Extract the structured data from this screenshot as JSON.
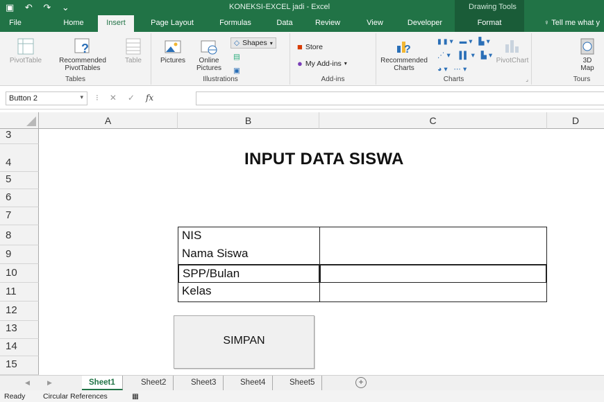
{
  "titlebar": {
    "title": "KONEKSI-EXCEL jadi - Excel",
    "context_tab": "Drawing Tools"
  },
  "tabs": [
    "File",
    "Home",
    "Insert",
    "Page Layout",
    "Formulas",
    "Data",
    "Review",
    "View",
    "Developer",
    "Format"
  ],
  "active_tab": "Insert",
  "tell_me": "Tell me what y",
  "ribbon": {
    "tables": {
      "pivottable": "PivotTable",
      "recommended": "Recommended",
      "pivottables": "PivotTables",
      "table": "Table",
      "label": "Tables"
    },
    "illustrations": {
      "pictures": "Pictures",
      "online": "Online",
      "online2": "Pictures",
      "shapes": "Shapes",
      "label": "Illustrations"
    },
    "addins": {
      "store": "Store",
      "myaddins": "My Add-ins",
      "label": "Add-ins"
    },
    "charts": {
      "recommended": "Recommended",
      "charts": "Charts",
      "pivotchart": "PivotChart",
      "label": "Charts"
    },
    "tours": {
      "map_3d": "3D",
      "map": "Map",
      "label": "Tours"
    }
  },
  "formula_bar": {
    "name_box": "Button 2",
    "fx": "fx",
    "value": ""
  },
  "columns": [
    "A",
    "B",
    "C",
    "D"
  ],
  "rows": [
    "3",
    "4",
    "5",
    "6",
    "7",
    "8",
    "9",
    "10",
    "11",
    "12",
    "13",
    "14",
    "15"
  ],
  "sheet": {
    "title": "INPUT DATA SISWA",
    "form_labels": [
      "NIS",
      "Nama Siswa",
      "SPP/Bulan",
      "Kelas"
    ],
    "form_values": [
      "",
      "",
      "",
      ""
    ],
    "button_label": "SIMPAN"
  },
  "sheet_tabs": [
    "Sheet1",
    "Sheet2",
    "Sheet3",
    "Sheet4",
    "Sheet5"
  ],
  "active_sheet": "Sheet1",
  "status": {
    "ready": "Ready",
    "circular": "Circular References"
  },
  "colors": {
    "excel_green": "#217346",
    "ribbon_bg": "#f3f3f3",
    "header_bg": "#f2f2f2"
  }
}
